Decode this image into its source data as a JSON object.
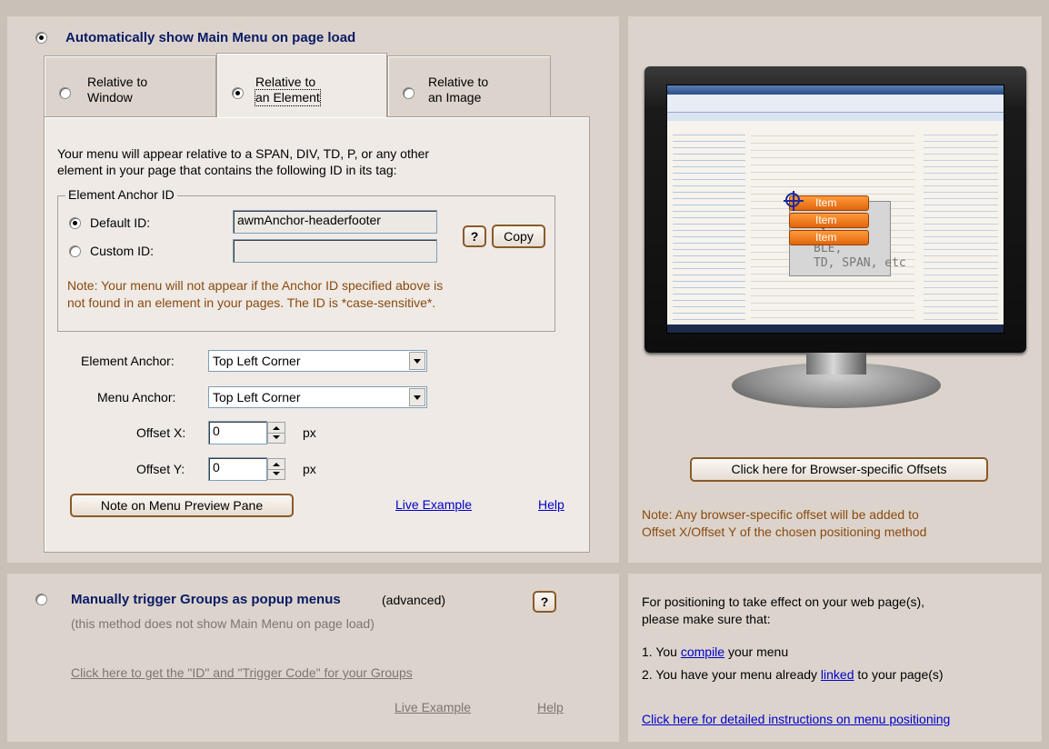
{
  "auto_section": {
    "title": "Automatically show Main Menu on page load",
    "tabs": [
      {
        "line1": "Relative to",
        "line2": "Window"
      },
      {
        "line1": "Relative to",
        "line2": "an Element"
      },
      {
        "line1": "Relative to",
        "line2": "an Image"
      }
    ],
    "description_line1": "Your menu will appear relative to a SPAN, DIV, TD, P, or any other",
    "description_line2": "element in your page that contains the following ID in its tag:",
    "anchor_group": {
      "legend": "Element Anchor ID",
      "default_label": "Default ID:",
      "default_value": "awmAnchor-headerfooter",
      "custom_label": "Custom ID:",
      "custom_value": "",
      "help_label": "?",
      "copy_label": "Copy",
      "note_line1": "Note: Your menu will not appear if the Anchor ID specified above is",
      "note_line2": "not found in an element in your pages. The ID is *case-sensitive*."
    },
    "element_anchor_label": "Element Anchor:",
    "element_anchor_value": "Top Left Corner",
    "menu_anchor_label": "Menu Anchor:",
    "menu_anchor_value": "Top Left Corner",
    "offset_x_label": "Offset X:",
    "offset_x_value": "0",
    "offset_y_label": "Offset Y:",
    "offset_y_value": "0",
    "px_unit": "px",
    "note_button_label": "Note on Menu Preview Pane",
    "live_example_label": "Live Example",
    "help_label": "Help"
  },
  "preview_section": {
    "preview_text": "ment\nple:\nBLE,\nTD, SPAN, etc",
    "item_label": "Item",
    "browser_offsets_button": "Click here for Browser-specific Offsets",
    "note_line1": "Note: Any browser-specific offset will be added to",
    "note_line2": "Offset X/Offset Y of the chosen positioning method"
  },
  "manual_section": {
    "title": "Manually trigger Groups as popup menus",
    "advanced": "(advanced)",
    "help_label": "?",
    "subtitle": "(this method does not show Main Menu on page load)",
    "get_id_link": "Click here to get the \"ID\" and \"Trigger Code\" for your Groups",
    "live_example_label": "Live Example",
    "help_link_label": "Help"
  },
  "info_section": {
    "line1": "For positioning to take effect on your web page(s),",
    "line2": "please make sure that:",
    "item1_prefix": "1. You ",
    "item1_link": "compile",
    "item1_suffix": " your menu",
    "item2_prefix": "2. You have your menu already ",
    "item2_link": "linked",
    "item2_suffix": " to your page(s)",
    "instructions_link": "Click here for detailed instructions on menu positioning"
  },
  "state": {
    "auto_selected": true,
    "active_tab": 1,
    "default_id_selected": true
  }
}
